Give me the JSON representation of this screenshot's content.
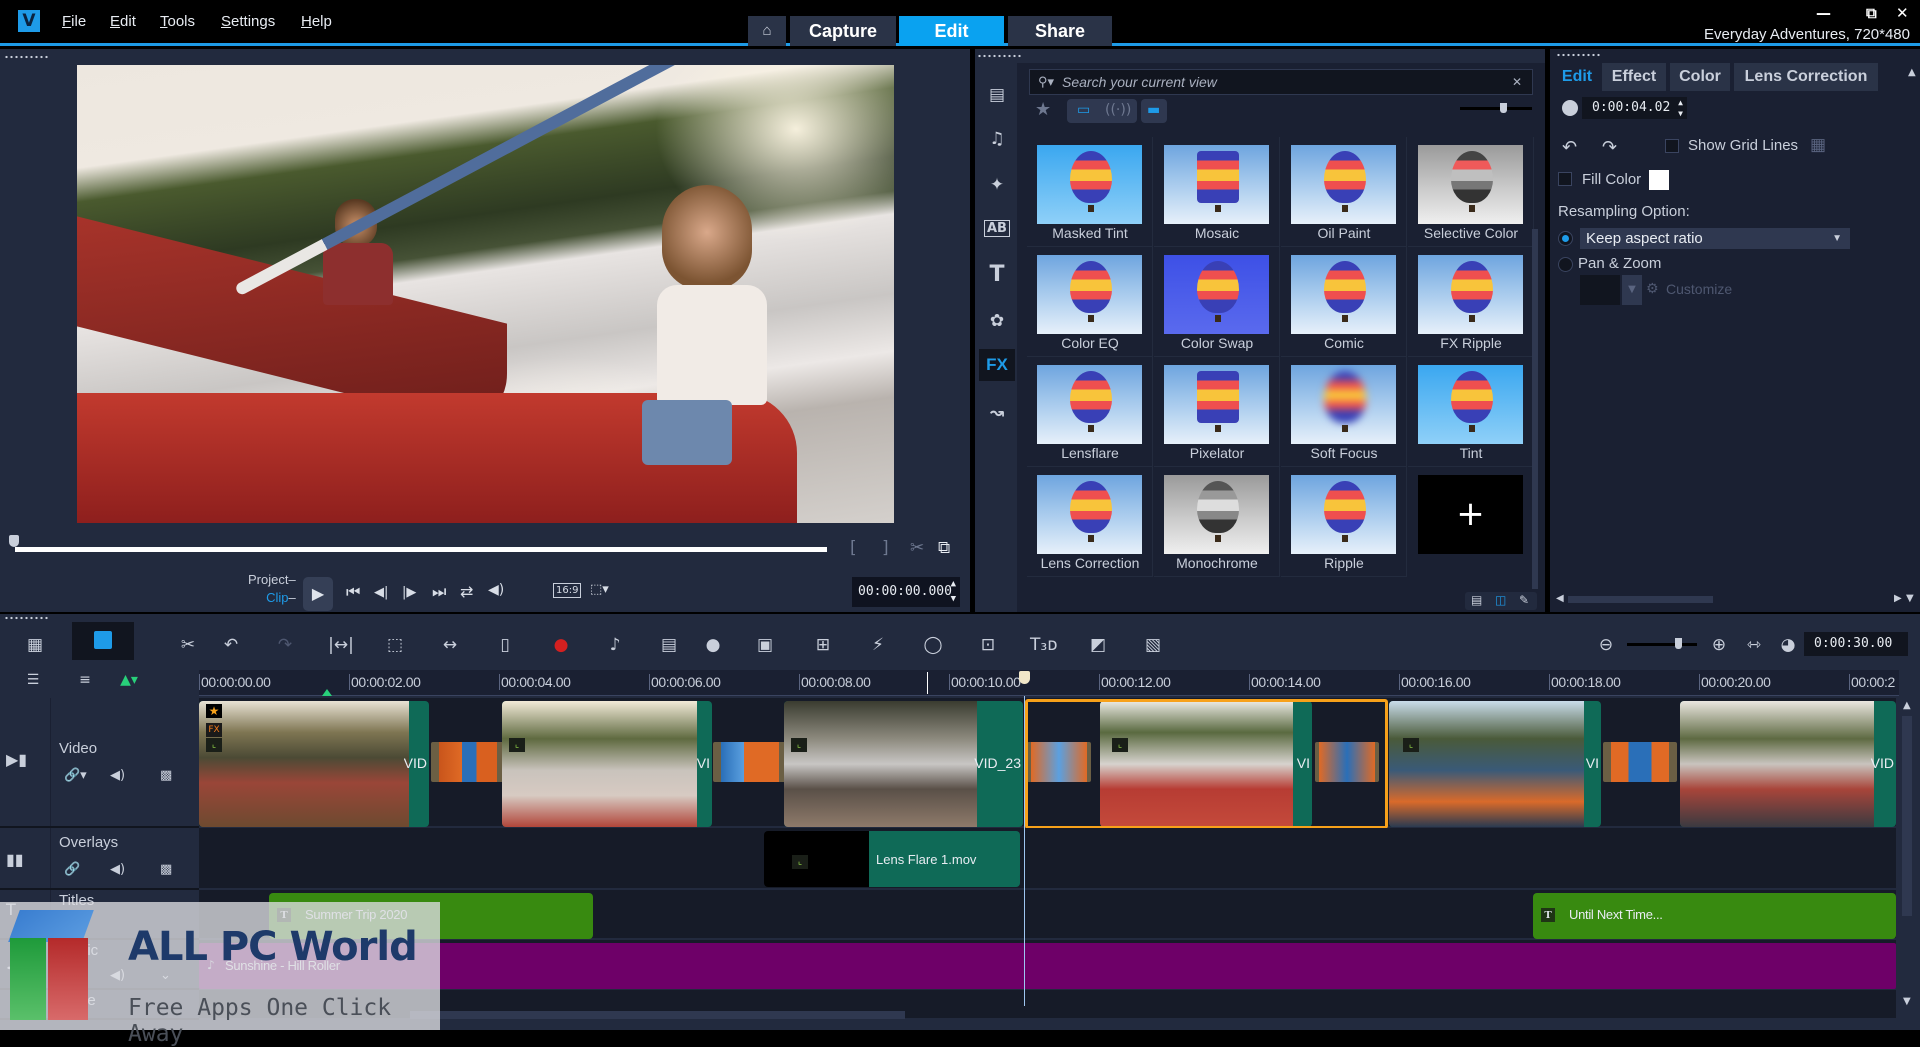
{
  "app": {
    "menu": [
      "File",
      "Edit",
      "Tools",
      "Settings",
      "Help"
    ],
    "mode_tabs": [
      {
        "label": "Capture",
        "active": false
      },
      {
        "label": "Edit",
        "active": true
      },
      {
        "label": "Share",
        "active": false
      }
    ],
    "home_icon": "home-icon",
    "project_info": "Everyday Adventures, 720*480",
    "window_controls": {
      "minimize": "—",
      "restore": "⧉",
      "close": "✕"
    },
    "accent_color": "#1e9be8"
  },
  "preview": {
    "mode_project": "Project",
    "mode_clip": "Clip",
    "timecode": "00:00:00.000",
    "aspect_label": "16:9",
    "controls": {
      "play": "▶",
      "home": "⏮",
      "prev_frame": "◀|",
      "next_frame": "|▶",
      "end": "⏭",
      "repeat": "⇄",
      "volume": "🔊"
    }
  },
  "library": {
    "search_placeholder": "Search your current view",
    "categories": [
      {
        "name": "media",
        "glyph": "▤"
      },
      {
        "name": "audio",
        "glyph": "♫"
      },
      {
        "name": "instant-project",
        "glyph": "✦"
      },
      {
        "name": "transition",
        "glyph": "AB"
      },
      {
        "name": "title",
        "glyph": "T"
      },
      {
        "name": "graphics",
        "glyph": "✿"
      },
      {
        "name": "filter",
        "glyph": "FX"
      },
      {
        "name": "path",
        "glyph": "↝"
      }
    ],
    "active_category": "FX",
    "filters": [
      {
        "label": "Masked Tint",
        "style": "bright"
      },
      {
        "label": "Mosaic",
        "style": "pixel"
      },
      {
        "label": "Oil Paint",
        "style": "normal"
      },
      {
        "label": "Selective Color",
        "style": "gray"
      },
      {
        "label": "Color EQ",
        "style": "normal"
      },
      {
        "label": "Color Swap",
        "style": "purple"
      },
      {
        "label": "Comic",
        "style": "normal"
      },
      {
        "label": "FX Ripple",
        "style": "normal"
      },
      {
        "label": "Lensflare",
        "style": "normal"
      },
      {
        "label": "Pixelator",
        "style": "pixel"
      },
      {
        "label": "Soft Focus",
        "style": "blur"
      },
      {
        "label": "Tint",
        "style": "bright"
      },
      {
        "label": "Lens Correction",
        "style": "normal"
      },
      {
        "label": "Monochrome",
        "style": "mono"
      },
      {
        "label": "Ripple",
        "style": "normal"
      },
      {
        "label": "",
        "style": "add"
      }
    ],
    "add_glyph": "+"
  },
  "options": {
    "tabs": [
      {
        "label": "Edit",
        "active": true
      },
      {
        "label": "Effect",
        "active": false
      },
      {
        "label": "Color",
        "active": false
      },
      {
        "label": "Lens Correction",
        "active": false
      }
    ],
    "duration": "0:00:04.02",
    "show_grid_lines": {
      "label": "Show Grid Lines",
      "checked": false
    },
    "fill_color": {
      "label": "Fill Color",
      "checked": false,
      "color": "#ffffff"
    },
    "resampling_label": "Resampling Option:",
    "resampling_options": [
      {
        "label": "Keep aspect ratio",
        "selected": true
      },
      {
        "label": "Pan & Zoom",
        "selected": false
      }
    ],
    "customize_label": "Customize"
  },
  "timeline": {
    "duration": "0:00:30.00",
    "ruler": [
      "00:00:00.00",
      "00:00:02.00",
      "00:00:04.00",
      "00:00:06.00",
      "00:00:08.00",
      "00:00:10.00",
      "00:00:12.00",
      "00:00:14.00",
      "00:00:16.00",
      "00:00:18.00",
      "00:00:20.00",
      "00:00:2"
    ],
    "playhead_time_seconds": 10.0,
    "tracks": [
      {
        "name": "Video",
        "icon": "video-track-icon"
      },
      {
        "name": "Overlays",
        "icon": "overlay-track-icon"
      },
      {
        "name": "Titles",
        "icon": "title-track-icon"
      },
      {
        "name": "Music",
        "icon": "music-track-icon"
      },
      {
        "name": "Voice",
        "icon": "voice-track-icon"
      }
    ],
    "video_clips": [
      {
        "label": "VID",
        "has_fx": true,
        "has_star": true
      },
      {
        "label": "VI"
      },
      {
        "label": "VID_23"
      },
      {
        "label": "VI",
        "selected": true
      },
      {
        "label": "VI"
      },
      {
        "label": "VID"
      }
    ],
    "overlay_clip": "Lens Flare 1.mov",
    "title_clips": [
      "Summer Trip 2020",
      "Until Next Time..."
    ],
    "music_clip": "Sunshine - Hill Roller",
    "clip_colors": {
      "video": "#0f6a57",
      "title": "#388a10",
      "music": "#6e0068",
      "selection": "#f7a11a"
    }
  },
  "watermark": {
    "title": "ALL PC World",
    "subtitle": "Free Apps One Click Away"
  }
}
